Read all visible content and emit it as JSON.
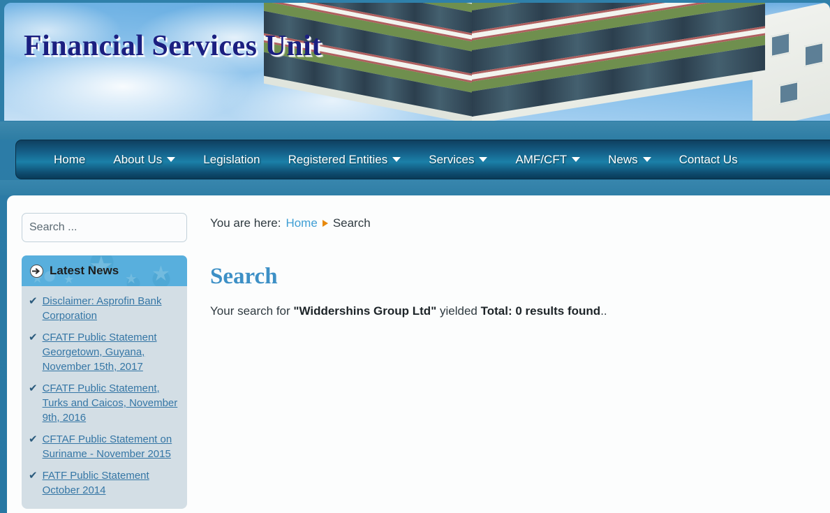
{
  "site": {
    "title": "Financial Services Unit"
  },
  "nav": {
    "items": [
      {
        "label": "Home",
        "has_dropdown": false
      },
      {
        "label": "About Us",
        "has_dropdown": true
      },
      {
        "label": "Legislation",
        "has_dropdown": false
      },
      {
        "label": "Registered Entities",
        "has_dropdown": true
      },
      {
        "label": "Services",
        "has_dropdown": true
      },
      {
        "label": "AMF/CFT",
        "has_dropdown": true
      },
      {
        "label": "News",
        "has_dropdown": true
      },
      {
        "label": "Contact Us",
        "has_dropdown": false
      }
    ]
  },
  "sidebar": {
    "search": {
      "placeholder": "Search ...",
      "value": ""
    },
    "news_module": {
      "heading": "Latest News",
      "icon": "circle-arrow-right-icon",
      "items": [
        {
          "label": "Disclaimer: Asprofin Bank Corporation"
        },
        {
          "label": "CFATF Public Statement Georgetown, Guyana, November 15th, 2017"
        },
        {
          "label": "CFATF Public Statement, Turks and Caicos, November 9th, 2016"
        },
        {
          "label": "CFTAF Public Statement on Suriname - November 2015"
        },
        {
          "label": "FATF Public Statement October 2014"
        }
      ]
    }
  },
  "main": {
    "breadcrumb": {
      "prefix": "You are here:",
      "home": "Home",
      "current": "Search"
    },
    "page_title": "Search",
    "result": {
      "lead": "Your search for",
      "query": "\"Widdershins Group Ltd\"",
      "middle": "yielded",
      "total": "Total: 0 results found",
      "trailing": ".."
    }
  },
  "colors": {
    "accent_blue": "#3d90c6",
    "link_blue": "#3576a5",
    "breadcrumb_link": "#3f9ed4",
    "breadcrumb_arrow": "#e8890c",
    "page_background": "#2b7ba6",
    "nav_dark": "#0e3f5f",
    "nav_light": "#1b80a8",
    "news_panel": "#d3dee5",
    "news_header": "#58afdd",
    "title_navy": "#1b1f80"
  }
}
